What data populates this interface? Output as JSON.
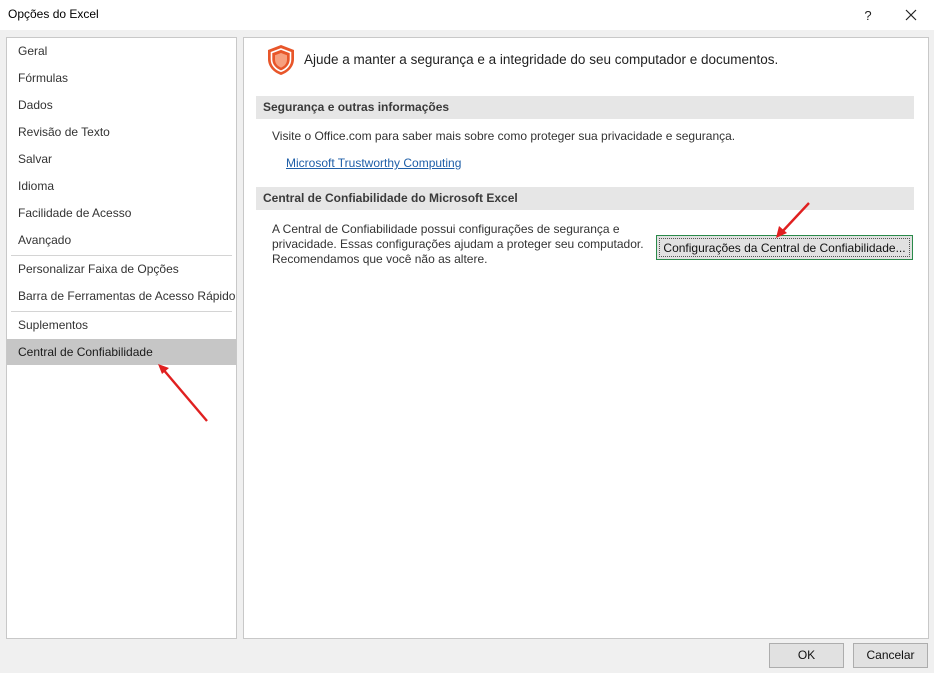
{
  "window": {
    "title": "Opções do Excel",
    "help_glyph": "?"
  },
  "sidebar": {
    "items": [
      {
        "label": "Geral"
      },
      {
        "label": "Fórmulas"
      },
      {
        "label": "Dados"
      },
      {
        "label": "Revisão de Texto"
      },
      {
        "label": "Salvar"
      },
      {
        "label": "Idioma"
      },
      {
        "label": "Facilidade de Acesso"
      },
      {
        "label": "Avançado"
      },
      {
        "label": "Personalizar Faixa de Opções"
      },
      {
        "label": "Barra de Ferramentas de Acesso Rápido"
      },
      {
        "label": "Suplementos"
      },
      {
        "label": "Central de Confiabilidade",
        "selected": true
      }
    ]
  },
  "content": {
    "header": "Ajude a manter a segurança e a integridade do seu computador e documentos.",
    "section1": {
      "title": "Segurança e outras informações",
      "text": "Visite o Office.com para saber mais sobre como proteger sua privacidade e segurança.",
      "link": "Microsoft Trustworthy Computing"
    },
    "section2": {
      "title": "Central de Confiabilidade do Microsoft Excel",
      "text_line1": "A Central de Confiabilidade possui configurações de segurança e",
      "text_line2": "privacidade. Essas configurações ajudam a proteger seu computador.",
      "text_line3": "Recomendamos que você não as altere.",
      "button": "Configurações da Central de Confiabilidade..."
    }
  },
  "footer": {
    "ok": "OK",
    "cancel": "Cancelar"
  },
  "colors": {
    "shield": "#e8562a",
    "annotation_arrow": "#e02020",
    "selected_item": "#c6c6c6",
    "link": "#1f5fa8"
  },
  "icons": {
    "shield": "shield-icon",
    "close": "close-icon"
  }
}
